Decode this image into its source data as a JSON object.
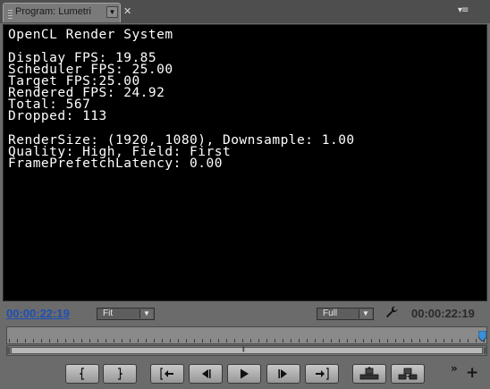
{
  "tab": {
    "title": "Program: Lumetri",
    "menu_glyph": "▼",
    "close_glyph": "✕"
  },
  "panel_menu_glyph": "▾≡",
  "overlay": {
    "lines": [
      "OpenCL Render System",
      "",
      "Display FPS: 19.85",
      "Scheduler FPS: 25.00",
      "Target FPS:25.00",
      "Rendered FPS: 24.92",
      "Total: 567",
      "Dropped: 113",
      "",
      "RenderSize: (1920, 1080), Downsample: 1.00",
      "Quality: High, Field: First",
      "FramePrefetchLatency: 0.00"
    ]
  },
  "controls": {
    "current_timecode": "00:00:22:19",
    "zoom": {
      "value": "Fit",
      "arrow": "▼"
    },
    "resolution": {
      "value": "Full",
      "arrow": "▼"
    },
    "duration_timecode": "00:00:22:19"
  },
  "transport": {
    "buttons": [
      {
        "name": "mark-in",
        "glyph": "{"
      },
      {
        "name": "mark-out",
        "glyph": "}"
      },
      {
        "name": "go-to-in",
        "glyph": "{←"
      },
      {
        "name": "step-back",
        "glyph": "◀|"
      },
      {
        "name": "play",
        "glyph": "▶"
      },
      {
        "name": "step-forward",
        "glyph": "|▶"
      },
      {
        "name": "go-to-out",
        "glyph": "→}"
      },
      {
        "name": "lift",
        "glyph": "lift"
      },
      {
        "name": "extract",
        "glyph": "extract"
      }
    ],
    "more_glyph": "»",
    "add_glyph": "+"
  },
  "colors": {
    "timecode_active": "#1e4fb5",
    "timecode_inactive": "#2a2a2a",
    "playhead": "#3a8fd8"
  },
  "scrub_bar": {
    "grip_glyph": "|||"
  }
}
